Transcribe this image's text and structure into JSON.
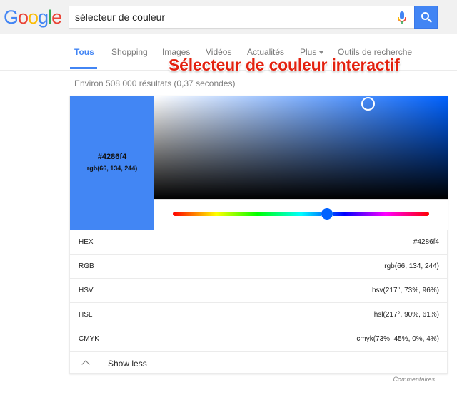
{
  "header": {
    "logo_letters": [
      {
        "char": "G",
        "color": "#4285f4"
      },
      {
        "char": "o",
        "color": "#ea4335"
      },
      {
        "char": "o",
        "color": "#fbbc05"
      },
      {
        "char": "g",
        "color": "#4285f4"
      },
      {
        "char": "l",
        "color": "#34a853"
      },
      {
        "char": "e",
        "color": "#ea4335"
      }
    ],
    "search_query": "sélecteur de couleur",
    "mic_icon": "microphone-icon",
    "search_icon": "search-icon",
    "accent_color": "#4285f4"
  },
  "tabs": [
    {
      "label": "Tous",
      "active": true
    },
    {
      "label": "Shopping",
      "active": false
    },
    {
      "label": "Images",
      "active": false
    },
    {
      "label": "Vidéos",
      "active": false
    },
    {
      "label": "Actualités",
      "active": false
    },
    {
      "label": "Plus",
      "active": false,
      "dropdown": true
    },
    {
      "label": "Outils de recherche",
      "active": false
    }
  ],
  "overlay_title": "Sélecteur de couleur interactif",
  "result_stats": "Environ 508 000 résultats (0,37 secondes)",
  "color_picker": {
    "selected_hex": "#4286f4",
    "selected_rgb": "rgb(66, 134, 244)",
    "swatch_color": "#4286f4",
    "hue_degrees": 217,
    "saturation_percent": 73,
    "value_percent": 96,
    "rows": [
      {
        "label": "HEX",
        "value": "#4286f4"
      },
      {
        "label": "RGB",
        "value": "rgb(66, 134, 244)"
      },
      {
        "label": "HSV",
        "value": "hsv(217°, 73%, 96%)"
      },
      {
        "label": "HSL",
        "value": "hsl(217°, 90%, 61%)"
      },
      {
        "label": "CMYK",
        "value": "cmyk(73%, 45%, 0%, 4%)"
      }
    ],
    "show_less_label": "Show less"
  },
  "feedback_label": "Commentaires"
}
